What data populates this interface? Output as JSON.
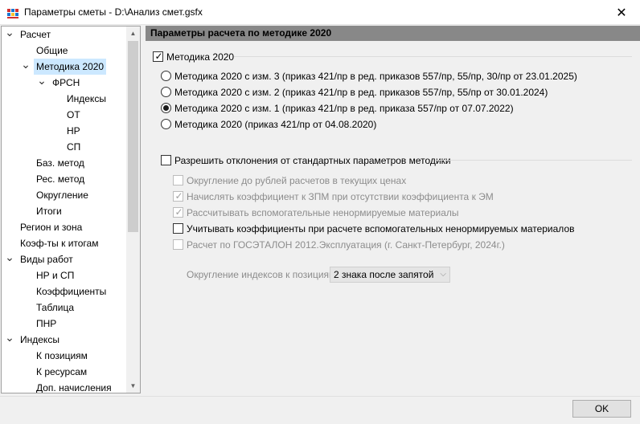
{
  "window": {
    "title": "Параметры сметы - D:\\Анализ смет.gsfx",
    "close_glyph": "✕"
  },
  "tree": {
    "items": [
      {
        "label": "Расчет",
        "expanded": true
      },
      {
        "label": "Общие"
      },
      {
        "label": "Методика 2020",
        "expanded": true,
        "selected": true
      },
      {
        "label": "ФРСН",
        "expanded": true
      },
      {
        "label": "Индексы"
      },
      {
        "label": "ОТ"
      },
      {
        "label": "НР"
      },
      {
        "label": "СП"
      },
      {
        "label": "Баз. метод"
      },
      {
        "label": "Рес. метод"
      },
      {
        "label": "Округление"
      },
      {
        "label": "Итоги"
      },
      {
        "label": "Регион и зона"
      },
      {
        "label": "Коэф-ты к итогам"
      },
      {
        "label": "Виды работ",
        "expanded": true
      },
      {
        "label": "НР и СП"
      },
      {
        "label": "Коэффициенты"
      },
      {
        "label": "Таблица"
      },
      {
        "label": "ПНР"
      },
      {
        "label": "Индексы",
        "expanded": true
      },
      {
        "label": "К позициям"
      },
      {
        "label": "К ресурсам"
      },
      {
        "label": "Доп. начисления"
      }
    ]
  },
  "panel": {
    "header": "Параметры расчета по методике 2020",
    "methodology_checkbox": {
      "label": "Методика 2020",
      "checked": true
    },
    "radios": [
      {
        "label": "Методика 2020 с изм. 3 (приказ 421/пр в ред. приказов 557/пр, 55/пр, 30/пр от 23.01.2025)",
        "selected": false
      },
      {
        "label": "Методика 2020 с изм. 2 (приказ 421/пр в ред. приказов 557/пр, 55/пр от 30.01.2024)",
        "selected": false
      },
      {
        "label": "Методика 2020 с изм. 1 (приказ 421/пр в ред. приказа 557/пр от 07.07.2022)",
        "selected": true
      },
      {
        "label": "Методика 2020 (приказ 421/пр от 04.08.2020)",
        "selected": false
      }
    ],
    "allow_deviations": {
      "label": "Разрешить отклонения от стандартных параметров методики",
      "checked": false
    },
    "sub_options": [
      {
        "label": "Округление до рублей расчетов в текущих ценах",
        "checked": false,
        "enabled": false
      },
      {
        "label": "Начислять коэффициент к ЗПМ при отсутствии коэффициента к ЭМ",
        "checked": true,
        "enabled": false
      },
      {
        "label": "Рассчитывать вспомогательные ненормируемые материалы",
        "checked": true,
        "enabled": false
      },
      {
        "label": "Учитывать коэффициенты при расчете вспомогательных ненормируемых материалов",
        "checked": false,
        "enabled": true
      },
      {
        "label": "Расчет по ГОСЭТАЛОН 2012.Эксплуатация (г. Санкт-Петербург, 2024г.)",
        "checked": false,
        "enabled": false
      }
    ],
    "rounding": {
      "label": "Округление индексов к позициям:",
      "value": "2 знака после запятой"
    }
  },
  "footer": {
    "ok_label": "OK"
  }
}
